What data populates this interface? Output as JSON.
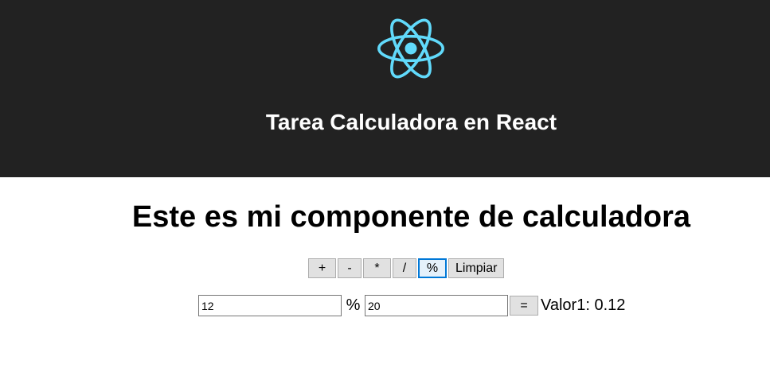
{
  "header": {
    "logo_icon": "react-atom-icon",
    "logo_color": "#61dafb",
    "background": "#222222",
    "title": "Tarea Calculadora en React"
  },
  "main": {
    "heading": "Este es mi componente de calculadora",
    "operations": [
      {
        "label": "+"
      },
      {
        "label": "-"
      },
      {
        "label": "*"
      },
      {
        "label": "/"
      },
      {
        "label": "%",
        "active": true
      },
      {
        "label": "Limpiar"
      }
    ],
    "calculator": {
      "value1": "12",
      "operator": "%",
      "value2": "20",
      "equals_label": "=",
      "result_text": "Valor1: 0.12"
    }
  }
}
